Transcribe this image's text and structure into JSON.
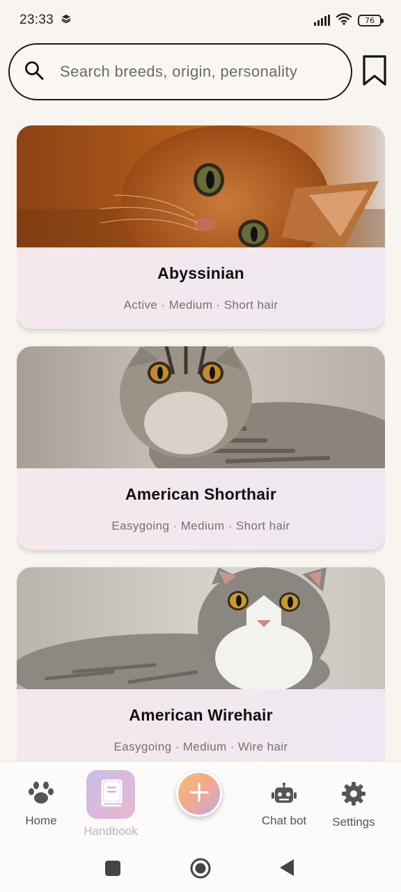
{
  "status_bar": {
    "time": "23:33",
    "battery_level": "76",
    "icons": [
      "layers-icon",
      "signal-icon",
      "wifi-icon",
      "battery-icon"
    ]
  },
  "search": {
    "placeholder": "Search breeds, origin, personality",
    "value": "",
    "icon": "search-icon",
    "bookmark_icon": "bookmark-icon"
  },
  "breeds": [
    {
      "name": "Abyssinian",
      "tags": "Active · Medium · Short hair"
    },
    {
      "name": "American Shorthair",
      "tags": "Easygoing · Medium · Short hair"
    },
    {
      "name": "American Wirehair",
      "tags": "Easygoing · Medium · Wire hair"
    }
  ],
  "bottom_nav": {
    "items": [
      {
        "label": "Home",
        "icon": "paw-icon"
      },
      {
        "label": "Handbook",
        "icon": "book-icon",
        "active": true
      },
      {
        "label": "Chat bot",
        "icon": "robot-icon"
      },
      {
        "label": "Settings",
        "icon": "gear-icon"
      }
    ],
    "fab_icon": "plus-icon"
  },
  "system_nav": {
    "icons": [
      "square-icon",
      "home-circle-icon",
      "back-triangle-icon"
    ]
  },
  "colors": {
    "background": "#f8f4ef",
    "card_info_bg": "#f3e9ef",
    "active_nav": "#bbb3c6"
  }
}
